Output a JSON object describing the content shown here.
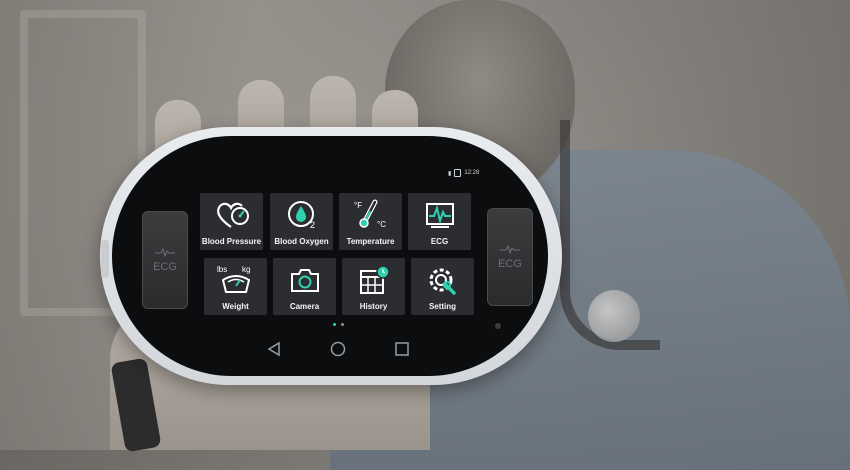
{
  "device": {
    "status": {
      "time": "12:28"
    },
    "ecg_pads": {
      "left_label": "ECG",
      "right_label": "ECG"
    },
    "apps": [
      {
        "label": "Blood Pressure",
        "icon": "heart-icon"
      },
      {
        "label": "Blood Oxygen",
        "icon": "droplet-o2-icon"
      },
      {
        "label": "Temperature",
        "icon": "thermometer-icon"
      },
      {
        "label": "ECG",
        "icon": "ecg-icon"
      },
      {
        "label": "Weight",
        "icon": "scale-icon",
        "icon_text_left": "lbs",
        "icon_text_right": "kg"
      },
      {
        "label": "Camera",
        "icon": "camera-icon"
      },
      {
        "label": "History",
        "icon": "calendar-clock-icon"
      },
      {
        "label": "Setting",
        "icon": "wrench-gear-icon"
      }
    ],
    "temp_units": {
      "f": "°F",
      "c": "°C"
    },
    "o2_sub": "2",
    "page_indicator": {
      "pages": 2,
      "active": 1
    },
    "nav": [
      "back-icon",
      "home-icon",
      "recents-icon"
    ],
    "colors": {
      "accent": "#2fd0b0",
      "tile": "#2b2d30",
      "screen": "#0c0d0e",
      "shell": "#e2e5e8"
    }
  }
}
